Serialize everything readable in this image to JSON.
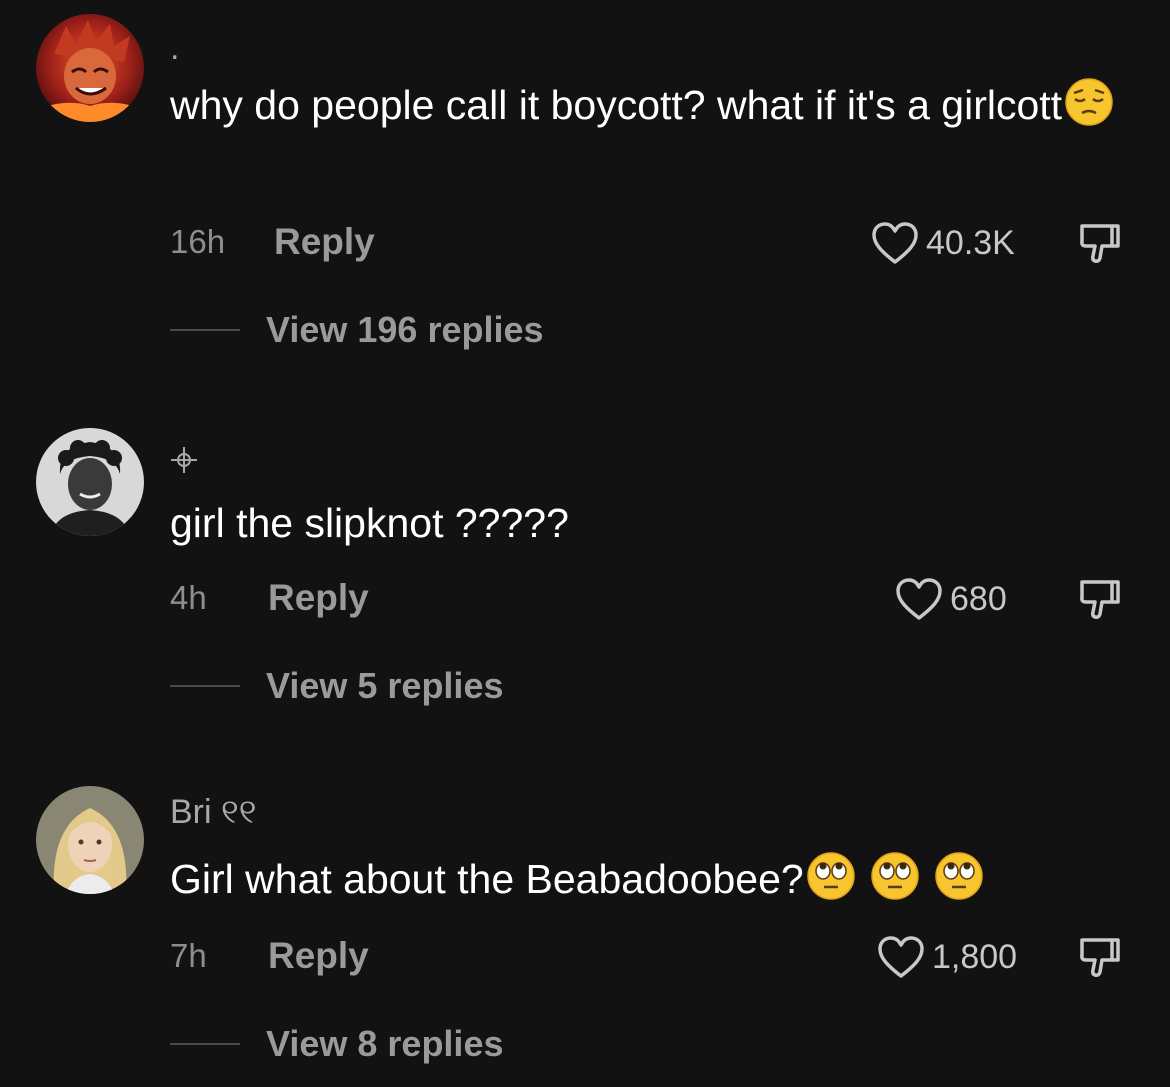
{
  "comments": [
    {
      "username": ".",
      "text": "why do people call it boycott? what if it's a girlcott",
      "emoji": [
        "pensive-face"
      ],
      "time": "16h",
      "reply_label": "Reply",
      "likes": "40.3K",
      "view_replies": "View 196 replies"
    },
    {
      "username": "",
      "username_icon": "crosshair-icon",
      "text": "girl the slipknot ?????",
      "emoji": [],
      "time": "4h",
      "reply_label": "Reply",
      "likes": "680",
      "view_replies": "View 5 replies"
    },
    {
      "username": "Bri ୧୧",
      "text": "Girl what about the Beabadoobee?",
      "emoji": [
        "face-with-rolling-eyes",
        "face-with-rolling-eyes",
        "face-with-rolling-eyes"
      ],
      "time": "7h",
      "reply_label": "Reply",
      "likes": "1,800",
      "view_replies": "View 8 replies"
    }
  ],
  "colors": {
    "background": "#121212",
    "text": "#ffffff",
    "muted": "#9a9a9a",
    "emoji_yellow": "#f7c52d"
  }
}
